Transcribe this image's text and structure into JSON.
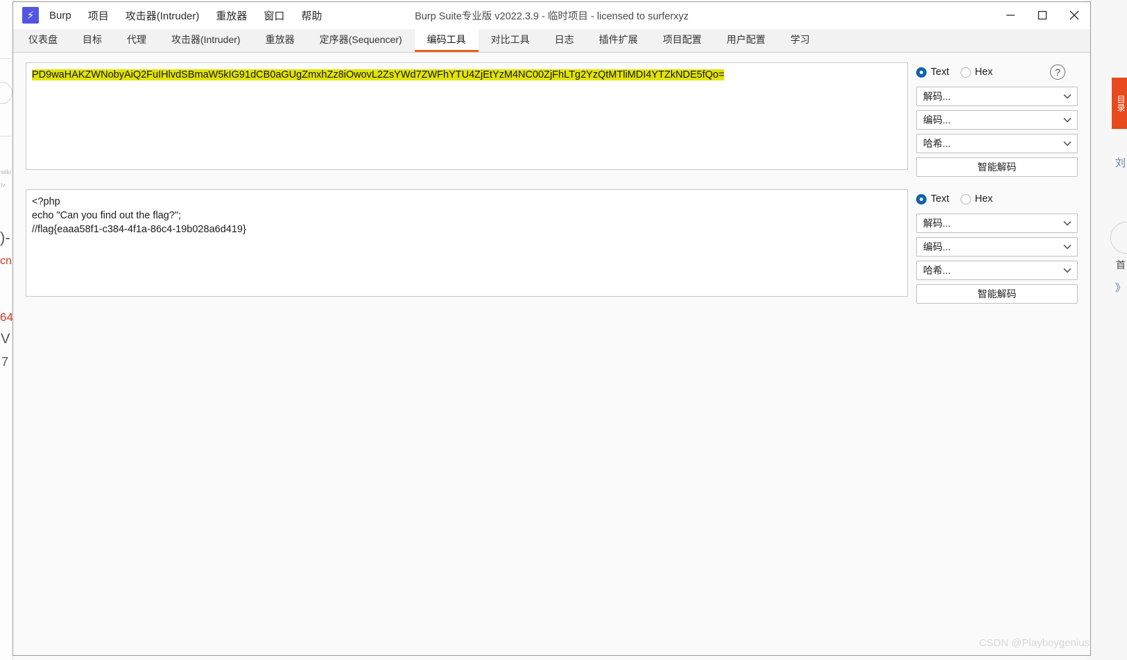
{
  "window": {
    "title": "Burp Suite专业版  v2022.3.9 - 临时项目 - licensed to surferxyz",
    "logo_glyph": "⚡",
    "controls": {
      "minimize": "minimize-icon",
      "maximize": "maximize-icon",
      "close": "close-icon"
    }
  },
  "menu": {
    "items": [
      {
        "label": "Burp"
      },
      {
        "label": "项目"
      },
      {
        "label": "攻击器(Intruder)"
      },
      {
        "label": "重放器"
      },
      {
        "label": "窗口"
      },
      {
        "label": "帮助"
      }
    ]
  },
  "tabs": {
    "active_index": 6,
    "items": [
      {
        "label": "仪表盘"
      },
      {
        "label": "目标"
      },
      {
        "label": "代理"
      },
      {
        "label": "攻击器(Intruder)"
      },
      {
        "label": "重放器"
      },
      {
        "label": "定序器(Sequencer)"
      },
      {
        "label": "编码工具"
      },
      {
        "label": "对比工具"
      },
      {
        "label": "日志"
      },
      {
        "label": "插件扩展"
      },
      {
        "label": "项目配置"
      },
      {
        "label": "用户配置"
      },
      {
        "label": "学习"
      }
    ]
  },
  "decoder": {
    "input_panel": {
      "content": "PD9waHAKZWNobyAiQ2FuIHlvdSBmaW5kIG91dCB0aGUgZmxhZz8iOwovL2ZsYWd7ZWFhYTU4ZjEtYzM4NC00ZjFhLTg2YzQtMTliMDI4YTZkNDE5fQo=",
      "highlighted": true,
      "view_mode": "Text",
      "radios": [
        {
          "label": "Text",
          "checked": true
        },
        {
          "label": "Hex",
          "checked": false
        }
      ],
      "help_glyph": "?",
      "combos": [
        {
          "label": "解码..."
        },
        {
          "label": "编码..."
        },
        {
          "label": "哈希..."
        }
      ],
      "smart_decode_label": "智能解码"
    },
    "output_panel": {
      "content": "<?php\necho \"Can you find out the flag?\";\n//flag{eaaa58f1-c384-4f1a-86c4-19b028a6d419}",
      "view_mode": "Text",
      "radios": [
        {
          "label": "Text",
          "checked": true
        },
        {
          "label": "Hex",
          "checked": false
        }
      ],
      "combos": [
        {
          "label": "解码..."
        },
        {
          "label": "编码..."
        },
        {
          "label": "哈希..."
        }
      ],
      "smart_decode_label": "智能解码"
    }
  },
  "background": {
    "right_tab_label": "目录",
    "scraps": [
      "wiki",
      "lv",
      "cn",
      "64",
      "V",
      "7"
    ]
  },
  "watermark": "CSDN @Playboygenius",
  "colors": {
    "accent": "#e8621a",
    "logo": "#5356e0",
    "radio": "#1062a8",
    "highlight": "#e3e300"
  }
}
